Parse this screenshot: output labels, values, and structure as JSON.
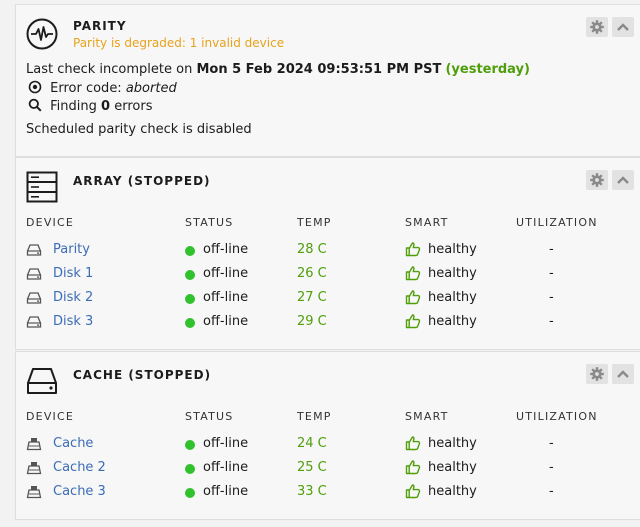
{
  "parity": {
    "title": "PARITY",
    "subtitle": "Parity is degraded: 1 invalid device",
    "last_check_prefix": "Last check incomplete on",
    "last_check_date": "Mon 5 Feb 2024 09:53:51 PM PST",
    "last_check_relative": "(yesterday)",
    "error_code_label": "Error code:",
    "error_code_value": "aborted",
    "finding_prefix": "Finding",
    "finding_count": "0",
    "finding_suffix": "errors",
    "schedule_text": "Scheduled parity check is disabled"
  },
  "columns": {
    "device": "DEVICE",
    "status": "STATUS",
    "temp": "TEMP",
    "smart": "SMART",
    "utilization": "UTILIZATION"
  },
  "array": {
    "title": "ARRAY (STOPPED)",
    "rows": [
      {
        "device": "Parity",
        "status": "off-line",
        "temp": "28 C",
        "smart": "healthy",
        "util": "-"
      },
      {
        "device": "Disk 1",
        "status": "off-line",
        "temp": "26 C",
        "smart": "healthy",
        "util": "-"
      },
      {
        "device": "Disk 2",
        "status": "off-line",
        "temp": "27 C",
        "smart": "healthy",
        "util": "-"
      },
      {
        "device": "Disk 3",
        "status": "off-line",
        "temp": "29 C",
        "smart": "healthy",
        "util": "-"
      }
    ]
  },
  "cache": {
    "title": "CACHE (STOPPED)",
    "rows": [
      {
        "device": "Cache",
        "status": "off-line",
        "temp": "24 C",
        "smart": "healthy",
        "util": "-"
      },
      {
        "device": "Cache 2",
        "status": "off-line",
        "temp": "25 C",
        "smart": "healthy",
        "util": "-"
      },
      {
        "device": "Cache 3",
        "status": "off-line",
        "temp": "33 C",
        "smart": "healthy",
        "util": "-"
      }
    ]
  },
  "colors": {
    "accent_orange": "#e8a21c",
    "ok_green": "#4f9e0b",
    "status_dot": "#31c12f",
    "link_blue": "#3b6cb4"
  },
  "icons": {
    "parity": "heartbeat-icon",
    "array": "server-rack-icon",
    "cache": "drive-icon",
    "settings": "gear-icon",
    "collapse": "chevron-up-icon",
    "error_code": "target-icon",
    "finding": "search-icon",
    "array_device": "hdd-icon",
    "cache_device": "ssd-icon",
    "smart": "thumbs-up-icon",
    "status": "status-dot"
  }
}
